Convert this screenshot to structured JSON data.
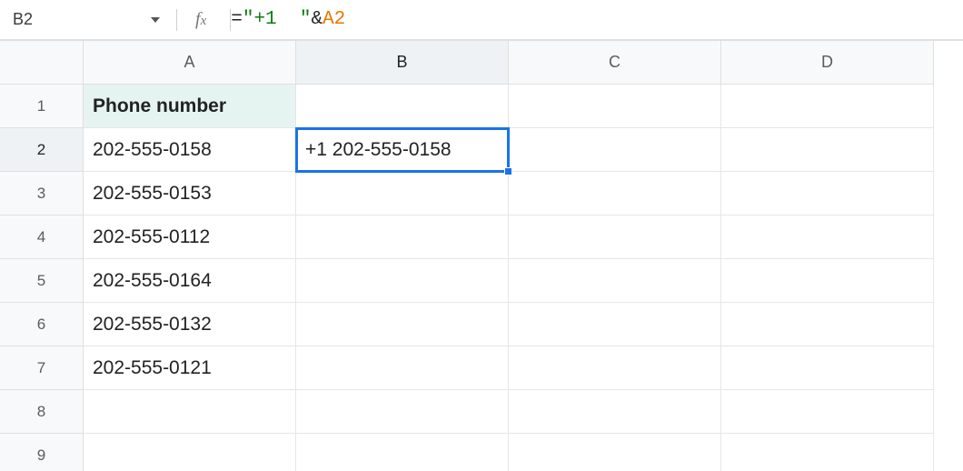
{
  "name_box": "B2",
  "formula_tokens": [
    {
      "cls": "tok-eq",
      "text": "="
    },
    {
      "cls": "tok-str",
      "text": "\"+1  \""
    },
    {
      "cls": "tok-op",
      "text": "&"
    },
    {
      "cls": "tok-ref",
      "text": "A2"
    }
  ],
  "columns": [
    "A",
    "B",
    "C",
    "D"
  ],
  "rows": [
    "1",
    "2",
    "3",
    "4",
    "5",
    "6",
    "7",
    "8",
    "9"
  ],
  "selected_cell": "B2",
  "cells": {
    "A1": {
      "value": "Phone number",
      "style": "header"
    },
    "A2": {
      "value": "202-555-0158"
    },
    "A3": {
      "value": "202-555-0153"
    },
    "A4": {
      "value": "202-555-0112"
    },
    "A5": {
      "value": "202-555-0164"
    },
    "A6": {
      "value": "202-555-0132"
    },
    "A7": {
      "value": "202-555-0121"
    },
    "B2": {
      "value": "+1 202-555-0158"
    }
  }
}
